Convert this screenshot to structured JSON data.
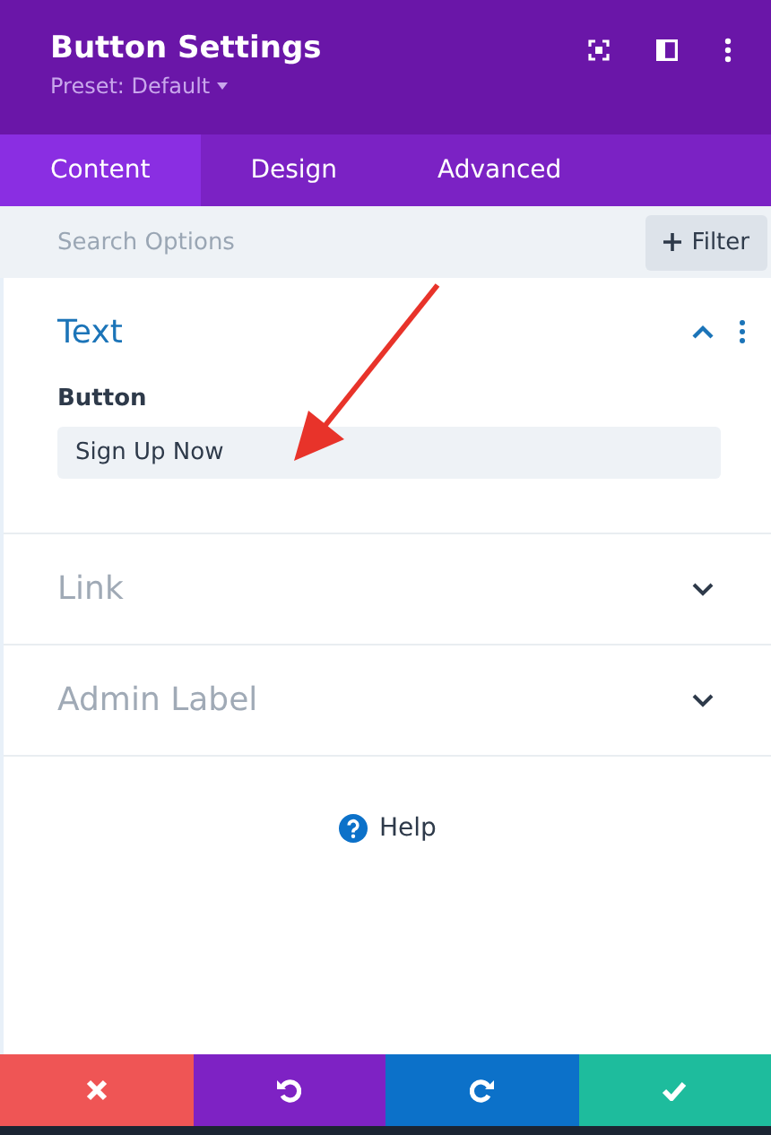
{
  "header": {
    "title": "Button Settings",
    "preset": "Preset: Default"
  },
  "tabs": [
    {
      "label": "Content",
      "selected": true
    },
    {
      "label": "Design",
      "selected": false
    },
    {
      "label": "Advanced",
      "selected": false
    }
  ],
  "search": {
    "placeholder": "Search Options",
    "filter_label": "Filter"
  },
  "sections": [
    {
      "title": "Text",
      "expanded": true,
      "fields": [
        {
          "label": "Button",
          "value": "Sign Up Now"
        }
      ]
    },
    {
      "title": "Link",
      "expanded": false
    },
    {
      "title": "Admin Label",
      "expanded": false
    }
  ],
  "help": "Help",
  "actions": [
    {
      "kind": "cancel",
      "color": "#ef5555"
    },
    {
      "kind": "undo",
      "color": "#7e22c4"
    },
    {
      "kind": "redo",
      "color": "#0c71c9"
    },
    {
      "kind": "save",
      "color": "#1ebc9d"
    }
  ]
}
